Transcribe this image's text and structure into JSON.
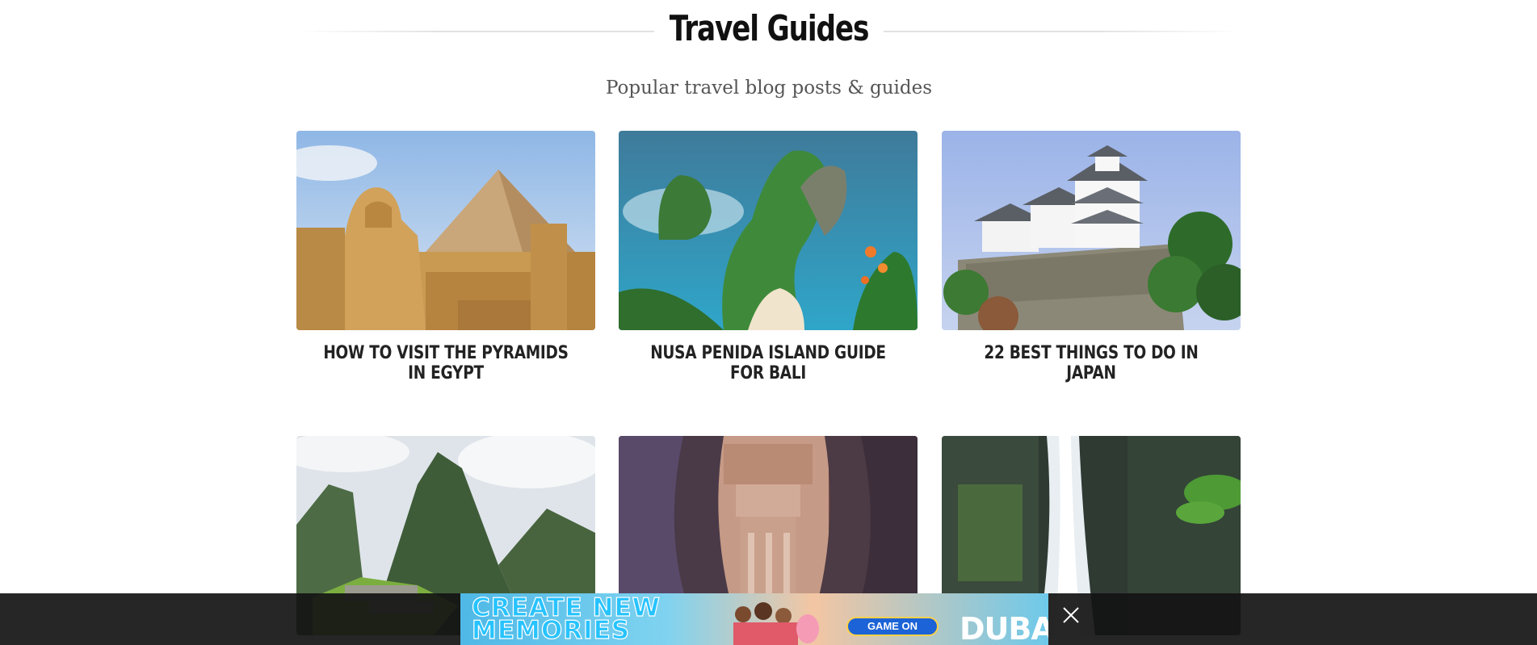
{
  "section": {
    "title": "Travel Guides",
    "subtitle": "Popular travel blog posts & guides"
  },
  "guides": [
    {
      "title": "HOW TO VISIT THE PYRAMIDS IN EGYPT",
      "image": "pyramids-sphinx"
    },
    {
      "title": "NUSA PENIDA ISLAND GUIDE FOR BALI",
      "image": "kelingking-beach"
    },
    {
      "title": "22 BEST THINGS TO DO IN JAPAN",
      "image": "himeji-castle"
    },
    {
      "title": "",
      "image": "machu-picchu"
    },
    {
      "title": "",
      "image": "petra-treasury"
    },
    {
      "title": "",
      "image": "waterfall"
    }
  ],
  "ad": {
    "headline": "CREATE NEW MEMORIES",
    "cta": "GAME ON",
    "brand": "DUBAI",
    "icons": [
      "adchoices-icon",
      "close-icon"
    ]
  }
}
